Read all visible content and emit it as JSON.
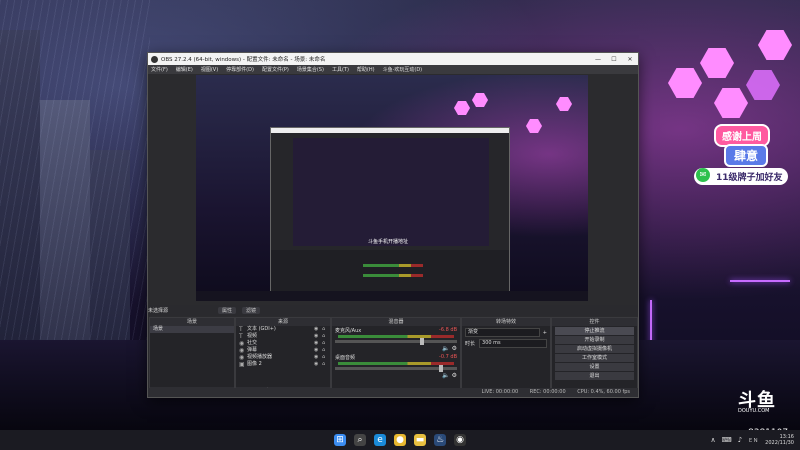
{
  "obs_window": {
    "title": "OBS 27.2.4 (64-bit, windows) - 配置文件: 未命名 - 场景: 未命名",
    "menu": [
      "文件(F)",
      "编辑(E)",
      "视图(V)",
      "停靠部件(D)",
      "配置文件(P)",
      "场景集合(S)",
      "工具(T)",
      "帮助(H)",
      "斗鱼-欢玩互动(D)"
    ],
    "window_buttons": [
      "—",
      "☐",
      "✕"
    ],
    "preview_caption": "斗鱼手机开播地址",
    "no_source_selected": "未选择源",
    "prop_buttons": [
      "属性",
      "滤镜"
    ],
    "docks": {
      "scenes": {
        "header": "场景",
        "items": [
          "场景"
        ],
        "footer": [
          "+",
          "−",
          "∧",
          "∨"
        ]
      },
      "sources": {
        "header": "来源",
        "items": [
          {
            "icon": "T",
            "label": "文本 (GDI+)"
          },
          {
            "icon": "T",
            "label": "视频"
          },
          {
            "icon": "◉",
            "label": "社交"
          },
          {
            "icon": "◉",
            "label": "弹幕"
          },
          {
            "icon": "◉",
            "label": "视频播放器"
          },
          {
            "icon": "▣",
            "label": "图像 2"
          }
        ],
        "footer": [
          "+",
          "−",
          "⚙",
          "∧",
          "∨"
        ]
      },
      "mixer": {
        "header": "混音器",
        "channels": [
          {
            "name": "麦克风/Aux",
            "db": "-6.8 dB",
            "level": 0.7
          },
          {
            "name": "桌面音频",
            "db": "-0.7 dB",
            "level": 0.85
          }
        ]
      },
      "transitions": {
        "header": "转场特效",
        "type": "渐变",
        "duration_label": "时长",
        "duration_value": "300 ms"
      },
      "controls": {
        "header": "控件",
        "buttons": [
          "停止推流",
          "开始录制",
          "启动虚拟摄像机",
          "工作室模式",
          "设置",
          "退出"
        ]
      }
    },
    "status": [
      "LIVE: 00:00:00",
      "REC: 00:00:00",
      "CPU: 0.4%, 60.00 fps"
    ]
  },
  "overlay": {
    "thanks": "感谢上周",
    "name": "肆意",
    "wechat_text": "11级牌子加好友",
    "logo": "斗鱼",
    "logo_sub": "DOUYU.COM",
    "room_id": "8381107"
  },
  "taskbar": {
    "apps": [
      {
        "name": "windows-start-icon",
        "glyph": "⊞",
        "color": "#3b8cf0"
      },
      {
        "name": "search-icon",
        "glyph": "⌕",
        "color": "#444"
      },
      {
        "name": "edge-icon",
        "glyph": "e",
        "color": "#1a8ad8"
      },
      {
        "name": "chrome-icon",
        "glyph": "●",
        "color": "#e8b830"
      },
      {
        "name": "folder-icon",
        "glyph": "▬",
        "color": "#e8c040"
      },
      {
        "name": "steam-icon",
        "glyph": "♨",
        "color": "#2a4a78"
      },
      {
        "name": "obs-icon",
        "glyph": "◉",
        "color": "#333"
      }
    ],
    "tray_icons": [
      "∧",
      "⌨",
      "♪",
      "ＥＮ"
    ],
    "time": "13:16",
    "date": "2022/11/30"
  }
}
